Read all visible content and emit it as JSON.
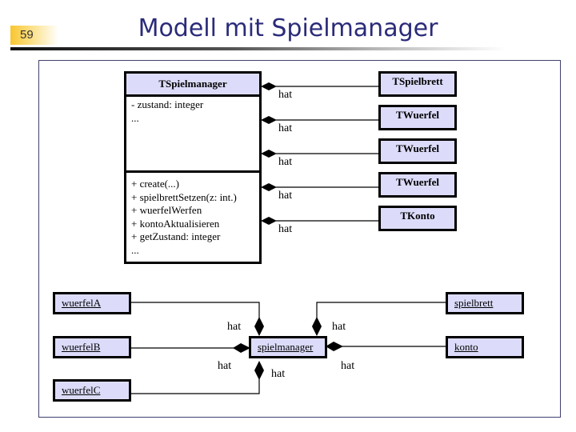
{
  "slide": {
    "number": "59",
    "title": "Modell mit Spielmanager"
  },
  "class_diagram": {
    "main_class": {
      "name": "TSpielmanager",
      "attributes": [
        "- zustand: integer",
        "..."
      ],
      "methods": [
        "+ create(...)",
        "+ spielbrettSetzen(z: int.)",
        "+ wuerfelWerfen",
        "+ kontoAktualisieren",
        "+ getZustand: integer",
        "..."
      ]
    },
    "associated_classes": [
      "TSpielbrett",
      "TWuerfel",
      "TWuerfel",
      "TWuerfel",
      "TKonto"
    ],
    "association_label": "hat"
  },
  "object_diagram": {
    "center": "spielmanager",
    "objects": {
      "wuerfelA": "wuerfelA",
      "wuerfelB": "wuerfelB",
      "wuerfelC": "wuerfelC",
      "spielbrett": "spielbrett",
      "konto": "konto"
    },
    "association_label": "hat"
  },
  "colors": {
    "title": "#2b2b7a",
    "box_fill": "#dcdcfa",
    "badge": "#f7c630"
  }
}
